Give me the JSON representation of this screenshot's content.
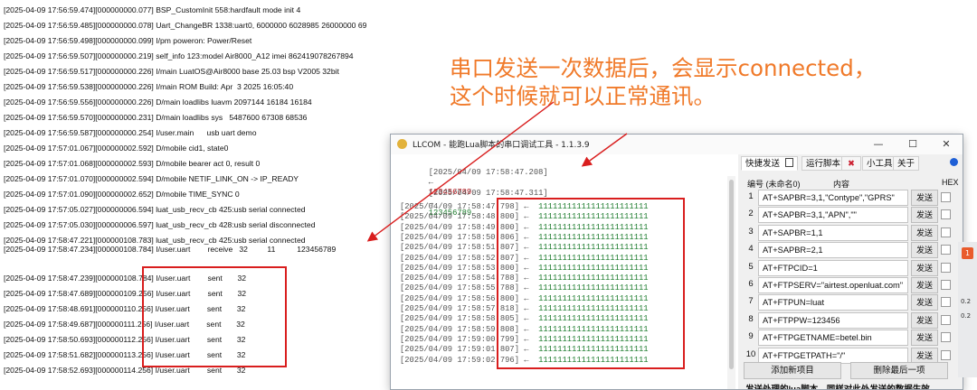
{
  "background_log": [
    "[2025-04-09 17:56:59.474][000000000.077] BSP_CustomInit 558:hardfault mode init 4",
    "[2025-04-09 17:56:59.485][000000000.078] Uart_ChangeBR 1338:uart0, 6000000 6028985 26000000 69",
    "[2025-04-09 17:56:59.498][000000000.099] I/pm poweron: Power/Reset",
    "[2025-04-09 17:56:59.507][000000000.219] self_info 123:model Air8000_A12 imei 862419078267894",
    "[2025-04-09 17:56:59.517][000000000.226] I/main LuatOS@Air8000 base 25.03 bsp V2005 32bit",
    "[2025-04-09 17:56:59.538][000000000.226] I/main ROM Build: Apr  3 2025 16:05:40",
    "[2025-04-09 17:56:59.556][000000000.226] D/main loadlibs luavm 2097144 16184 16184",
    "[2025-04-09 17:56:59.570][000000000.231] D/main loadlibs sys   5487600 67308 68536",
    "[2025-04-09 17:56:59.587][000000000.254] I/user.main      usb uart demo",
    "[2025-04-09 17:57:01.067][000000002.592] D/mobile cid1, state0",
    "[2025-04-09 17:57:01.068][000000002.593] D/mobile bearer act 0, result 0",
    "[2025-04-09 17:57:01.070][000000002.594] D/mobile NETIF_LINK_ON -> IP_READY",
    "[2025-04-09 17:57:01.090][000000002.652] D/mobile TIME_SYNC 0",
    "[2025-04-09 17:57:05.027][000000006.594] luat_usb_recv_cb 425:usb serial connected",
    "[2025-04-09 17:57:05.030][000000006.597] luat_usb_recv_cb 428:usb serial disconnected",
    "[2025-04-09 17:58:47.221][000000108.783] luat_usb_recv_cb 425:usb serial connected",
    "[2025-04-09 17:58:47.234][000000108.784] I/user.uart        receive   32         11          123456789",
    "",
    "[2025-04-09 17:58:47.239][000000108.784] I/user.uart        sent       32",
    "[2025-04-09 17:58:47.689][000000109.256] I/user.uart        sent       32",
    "[2025-04-09 17:58:48.691][000000110.256] I/user.uart        sent       32",
    "[2025-04-09 17:58:49.687][000000111.256] I/user.uart        sent       32",
    "[2025-04-09 17:58:50.693][000000112.256] I/user.uart        sent       32",
    "[2025-04-09 17:58:51.682][000000113.256] I/user.uart        sent       32",
    "[2025-04-09 17:58:52.693][000000114.256] I/user.uart        sent       32"
  ],
  "annotation": {
    "line1": "串口发送一次数据后，会显示connected，",
    "line2": "这个时候就可以正常通讯。"
  },
  "window": {
    "title": "LLCOM - 能跑Lua脚本的串口调试工具 - 1.1.3.9",
    "minimize": "—",
    "maximize": "☐",
    "close": "✕"
  },
  "com_log": {
    "rx_line": {
      "ts": "[2025/04/09 17:58:47.208]",
      "arrow": "←",
      "data": "123456789"
    },
    "tx_line": {
      "ts": "[2025/04/09 17:58:47.311]",
      "arrow": "→",
      "data": "123456789"
    },
    "rx_lines": [
      {
        "ts": "[2025/04/09 17:58:47.798]",
        "arrow": "←",
        "data": "11111111111111111111111"
      },
      {
        "ts": "[2025/04/09 17:58:48.800]",
        "arrow": "←",
        "data": "11111111111111111111111"
      },
      {
        "ts": "[2025/04/09 17:58:49.800]",
        "arrow": "←",
        "data": "11111111111111111111111"
      },
      {
        "ts": "[2025/04/09 17:58:50.806]",
        "arrow": "←",
        "data": "11111111111111111111111"
      },
      {
        "ts": "[2025/04/09 17:58:51.807]",
        "arrow": "←",
        "data": "11111111111111111111111"
      },
      {
        "ts": "[2025/04/09 17:58:52.807]",
        "arrow": "←",
        "data": "11111111111111111111111"
      },
      {
        "ts": "[2025/04/09 17:58:53.800]",
        "arrow": "←",
        "data": "11111111111111111111111"
      },
      {
        "ts": "[2025/04/09 17:58:54.788]",
        "arrow": "←",
        "data": "11111111111111111111111"
      },
      {
        "ts": "[2025/04/09 17:58:55.788]",
        "arrow": "←",
        "data": "11111111111111111111111"
      },
      {
        "ts": "[2025/04/09 17:58:56.800]",
        "arrow": "←",
        "data": "11111111111111111111111"
      },
      {
        "ts": "[2025/04/09 17:58:57.818]",
        "arrow": "←",
        "data": "11111111111111111111111"
      },
      {
        "ts": "[2025/04/09 17:58:58.805]",
        "arrow": "←",
        "data": "11111111111111111111111"
      },
      {
        "ts": "[2025/04/09 17:58:59.808]",
        "arrow": "←",
        "data": "11111111111111111111111"
      },
      {
        "ts": "[2025/04/09 17:59:00.799]",
        "arrow": "←",
        "data": "11111111111111111111111"
      },
      {
        "ts": "[2025/04/09 17:59:01.807]",
        "arrow": "←",
        "data": "11111111111111111111111"
      },
      {
        "ts": "[2025/04/09 17:59:02.796]",
        "arrow": "←",
        "data": "11111111111111111111111"
      }
    ]
  },
  "right_panel": {
    "tabs": [
      "快捷发送",
      "运行脚本",
      "小工具",
      "关于"
    ],
    "header": {
      "num": "编号 (未命名0)",
      "content": "内容",
      "hex": "HEX"
    },
    "send_label": "发送",
    "commands": [
      {
        "n": "1",
        "text": "AT+SAPBR=3,1,\"Contype\",\"GPRS\""
      },
      {
        "n": "2",
        "text": "AT+SAPBR=3,1,\"APN\",\"\""
      },
      {
        "n": "3",
        "text": "AT+SAPBR=1,1"
      },
      {
        "n": "4",
        "text": "AT+SAPBR=2,1"
      },
      {
        "n": "5",
        "text": "AT+FTPCID=1"
      },
      {
        "n": "6",
        "text": "AT+FTPSERV=\"airtest.openluat.com\""
      },
      {
        "n": "7",
        "text": "AT+FTPUN=luat"
      },
      {
        "n": "8",
        "text": "AT+FTPPW=123456"
      },
      {
        "n": "9",
        "text": "AT+FTPGETNAME=betel.bin"
      },
      {
        "n": "10",
        "text": "AT+FTPGETPATH=\"/\""
      }
    ],
    "add_button": "添加新项目",
    "delete_button": "删除最后一项",
    "footer_text": "发送处理的lua脚本，同样对此处发送的数据生效"
  },
  "side_strip": {
    "badge": "1",
    "label1": "0.2",
    "label2": "0.2"
  },
  "colors": {
    "annotation": "#f07a2a",
    "highlight_box": "#d91e1e",
    "rx": "#c0141b",
    "tx": "#1a7a2b"
  }
}
